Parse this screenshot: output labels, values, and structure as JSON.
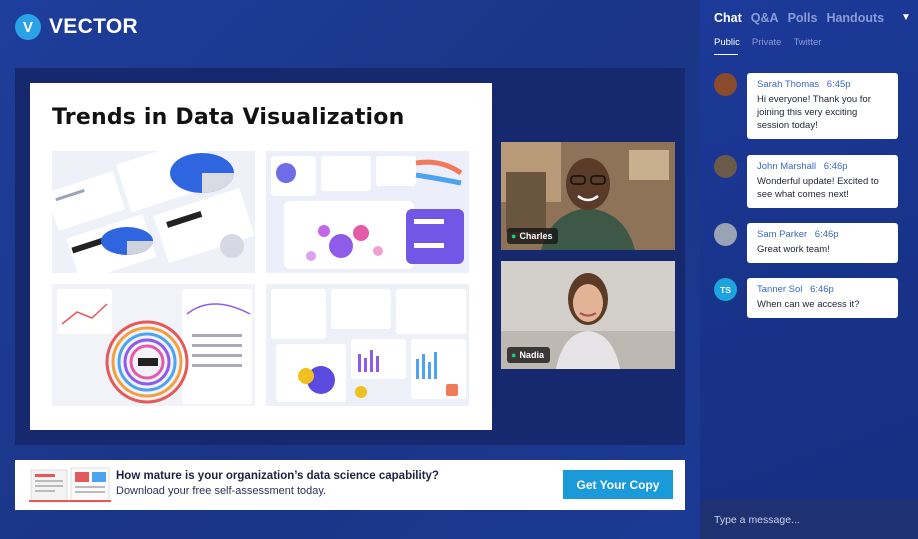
{
  "brand": {
    "logo_glyph": "V",
    "name": "VECTOR"
  },
  "slide": {
    "title": "Trends in Data Visualization"
  },
  "videos": [
    {
      "name": "Charles"
    },
    {
      "name": "Nadia"
    }
  ],
  "banner": {
    "title": "How mature is your organization’s data science capability?",
    "subtitle": "Download your free self-assessment today.",
    "cta_label": "Get Your Copy"
  },
  "chat": {
    "tabs": [
      "Chat",
      "Q&A",
      "Polls",
      "Handouts"
    ],
    "subtabs": [
      "Public",
      "Private",
      "Twitter"
    ],
    "messages": [
      {
        "author": "Sarah Thomas",
        "time": "6:45p",
        "text": "Hi everyone! Thank you for joining this very exciting session today!",
        "avatar_color": "#8a4a2c",
        "initials": ""
      },
      {
        "author": "John Marshall",
        "time": "6:46p",
        "text": "Wonderful update! Excited to see what comes next!",
        "avatar_color": "#6b5a4a",
        "initials": ""
      },
      {
        "author": "Sam Parker",
        "time": "6:46p",
        "text": "Great work team!",
        "avatar_color": "#9aa3b5",
        "initials": ""
      },
      {
        "author": "Tanner Sol",
        "time": "6:46p",
        "text": "When can we access it?",
        "avatar_color": "#1fa2e0",
        "initials": "TS"
      }
    ],
    "composer_placeholder": "Type a message..."
  }
}
